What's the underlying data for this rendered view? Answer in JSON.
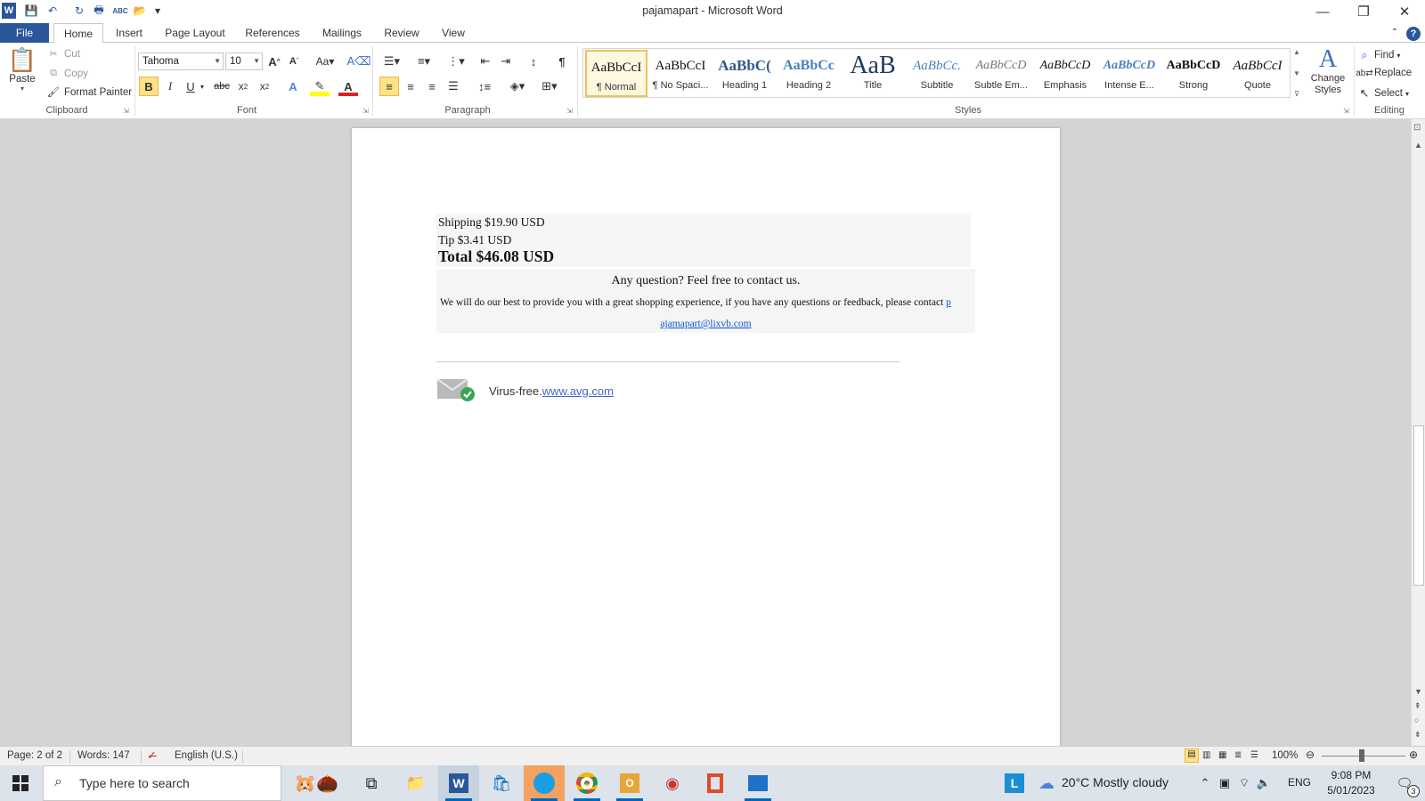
{
  "window": {
    "title": "pajamapart - Microsoft Word",
    "minimize_icon": "—",
    "restore_icon": "❐",
    "close_icon": "✕"
  },
  "quick_access": {
    "word_logo": "W",
    "save_icon": "💾",
    "undo_icon": "↶",
    "redo_icon": "↻",
    "print_icon": "🖶",
    "spelling_icon": "ABC",
    "open_icon": "📂",
    "customize_icon": "▾"
  },
  "tabs": [
    "File",
    "Home",
    "Insert",
    "Page Layout",
    "References",
    "Mailings",
    "Review",
    "View"
  ],
  "ribbon": {
    "clipboard": {
      "label": "Clipboard",
      "paste": "Paste",
      "cut": "Cut",
      "copy": "Copy",
      "format_painter": "Format Painter"
    },
    "font": {
      "label": "Font",
      "font_name": "Tahoma",
      "font_size": "10"
    },
    "paragraph": {
      "label": "Paragraph"
    },
    "styles": {
      "label": "Styles",
      "items": [
        {
          "sample": "AaBbCcI",
          "name": "¶ Normal"
        },
        {
          "sample": "AaBbCcI",
          "name": "¶ No Spaci..."
        },
        {
          "sample": "AaBbC(",
          "name": "Heading 1"
        },
        {
          "sample": "AaBbCc",
          "name": "Heading 2"
        },
        {
          "sample": "AaB",
          "name": "Title"
        },
        {
          "sample": "AaBbCc.",
          "name": "Subtitle"
        },
        {
          "sample": "AaBbCcD",
          "name": "Subtle Em..."
        },
        {
          "sample": "AaBbCcD",
          "name": "Emphasis"
        },
        {
          "sample": "AaBbCcD",
          "name": "Intense E..."
        },
        {
          "sample": "AaBbCcD",
          "name": "Strong"
        },
        {
          "sample": "AaBbCcI",
          "name": "Quote"
        }
      ],
      "change_styles": "Change Styles"
    },
    "editing": {
      "label": "Editing",
      "find": "Find",
      "replace": "Replace",
      "select": "Select"
    }
  },
  "document": {
    "shipping": "Shipping $19.90 USD",
    "tip": "Tip $3.41 USD",
    "total": "Total $46.08 USD",
    "contact_heading": "Any question? Feel free to contact us.",
    "contact_text": "We will do our best to provide you with a great shopping experience, if you have any questions or feedback, please contact",
    "email_part1": "p",
    "email_part2": "ajamapart@lixvb.com",
    "virus_free": "Virus-free.",
    "avg_link": "www.avg.com"
  },
  "statusbar": {
    "page": "Page: 2 of 2",
    "words": "Words: 147",
    "language": "English (U.S.)",
    "zoom": "100%"
  },
  "taskbar": {
    "search_placeholder": "Type here to search",
    "weather": "20°C  Mostly cloudy",
    "lang": "ENG",
    "time": "9:08 PM",
    "date": "5/01/2023",
    "notifications": "3"
  },
  "colors": {
    "accent": "#2b579a",
    "highlight": "#fde286"
  }
}
